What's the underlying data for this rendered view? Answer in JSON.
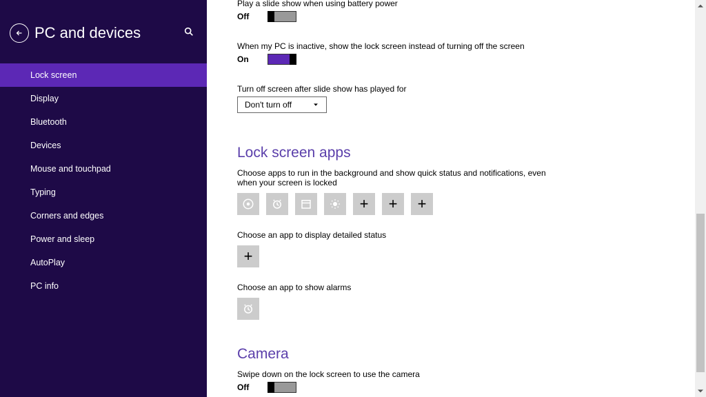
{
  "sidebar": {
    "title": "PC and devices",
    "items": [
      "Lock screen",
      "Display",
      "Bluetooth",
      "Devices",
      "Mouse and touchpad",
      "Typing",
      "Corners and edges",
      "Power and sleep",
      "AutoPlay",
      "PC info"
    ],
    "selected_index": 0
  },
  "settings": {
    "battery_slideshow": {
      "label": "Play a slide show when using battery power",
      "state": "Off"
    },
    "inactive_lock": {
      "label": "When my PC is inactive, show the lock screen instead of turning off the screen",
      "state": "On"
    },
    "turnoff_after": {
      "label": "Turn off screen after slide show has played for",
      "value": "Don't turn off"
    }
  },
  "lockscreen_apps": {
    "heading": "Lock screen apps",
    "quick_status_label": "Choose apps to run in the background and show quick status and notifications, even when your screen is locked",
    "detailed_label": "Choose an app to display detailed status",
    "alarms_label": "Choose an app to show alarms"
  },
  "camera": {
    "heading": "Camera",
    "swipe_label": "Swipe down on the lock screen to use the camera",
    "state": "Off"
  }
}
